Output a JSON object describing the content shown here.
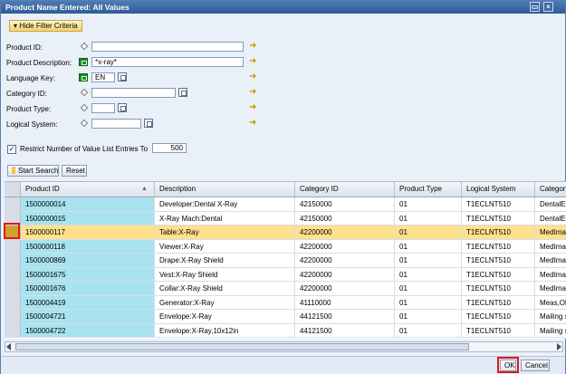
{
  "window": {
    "title": "Product Name Entered: All Values"
  },
  "filter": {
    "toggle_label": "Hide Filter Criteria",
    "fields": [
      {
        "label": "Product ID:",
        "value": ""
      },
      {
        "label": "Product Description:",
        "value": "*x-ray*"
      },
      {
        "label": "Language Key:",
        "value": "EN"
      },
      {
        "label": "Category ID:",
        "value": ""
      },
      {
        "label": "Product Type:",
        "value": ""
      },
      {
        "label": "Logical System:",
        "value": ""
      }
    ],
    "restrict_checked": true,
    "restrict_label": "Restrict Number of Value List Entries To",
    "restrict_value": "500",
    "start_search": "Start Search",
    "reset": "Reset"
  },
  "table": {
    "columns": [
      "Product ID",
      "Description",
      "Category ID",
      "Product Type",
      "Logical System",
      "Category"
    ],
    "rows": [
      [
        "1500000014",
        "Developer:Dental X-Ray",
        "42150000",
        "01",
        "T1ECLNT510",
        "DentalEqu"
      ],
      [
        "1500000015",
        "X-Ray Mach:Dental",
        "42150000",
        "01",
        "T1ECLNT510",
        "DentalEqu"
      ],
      [
        "1500000117",
        "Table:X-Ray",
        "42200000",
        "01",
        "T1ECLNT510",
        "MedImag"
      ],
      [
        "1500000118",
        "Viewer:X-Ray",
        "42200000",
        "01",
        "T1ECLNT510",
        "MedImag"
      ],
      [
        "1500000869",
        "Drape:X-Ray Shield",
        "42200000",
        "01",
        "T1ECLNT510",
        "MedImag"
      ],
      [
        "1500001675",
        "Vest:X-Ray Shield",
        "42200000",
        "01",
        "T1ECLNT510",
        "MedImag"
      ],
      [
        "1500001676",
        "Collar:X-Ray Shield",
        "42200000",
        "01",
        "T1ECLNT510",
        "MedImag"
      ],
      [
        "1500004419",
        "Generator:X-Ray",
        "41110000",
        "01",
        "T1ECLNT510",
        "Meas,Obs"
      ],
      [
        "1500004721",
        "Envelope:X-Ray",
        "44121500",
        "01",
        "T1ECLNT510",
        "Mailing su"
      ],
      [
        "1500004722",
        "Envelope:X-Ray,10x12in",
        "44121500",
        "01",
        "T1ECLNT510",
        "Mailing su"
      ]
    ],
    "sort_indicator": "▲"
  },
  "footer": {
    "ok": "OK",
    "cancel": "Cancel"
  }
}
